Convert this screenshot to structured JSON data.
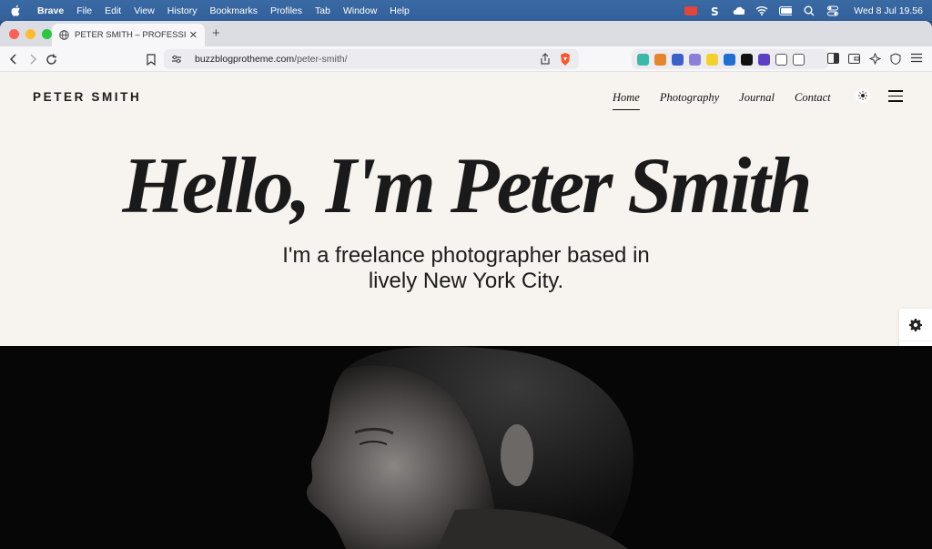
{
  "menubar": {
    "app": "Brave",
    "items": [
      "File",
      "Edit",
      "View",
      "History",
      "Bookmarks",
      "Profiles",
      "Tab",
      "Window",
      "Help"
    ],
    "clock": "Wed 8 Jul  19.56"
  },
  "browser": {
    "tab_title": "PETER SMITH – PROFESSIONA",
    "url_host": "buzzblogprotheme.com",
    "url_path": "/peter-smith/"
  },
  "site": {
    "logo": "PETER SMITH",
    "nav": [
      "Home",
      "Photography",
      "Journal",
      "Contact"
    ],
    "hero_title": "Hello, I'm Peter Smith",
    "hero_sub_line1": "I'm a freelance photographer based in",
    "hero_sub_line2": "lively New York City."
  },
  "colors": {
    "page_bg": "#f7f3ee",
    "menubar": "#3a6aa3",
    "photo_bg": "#060606"
  }
}
